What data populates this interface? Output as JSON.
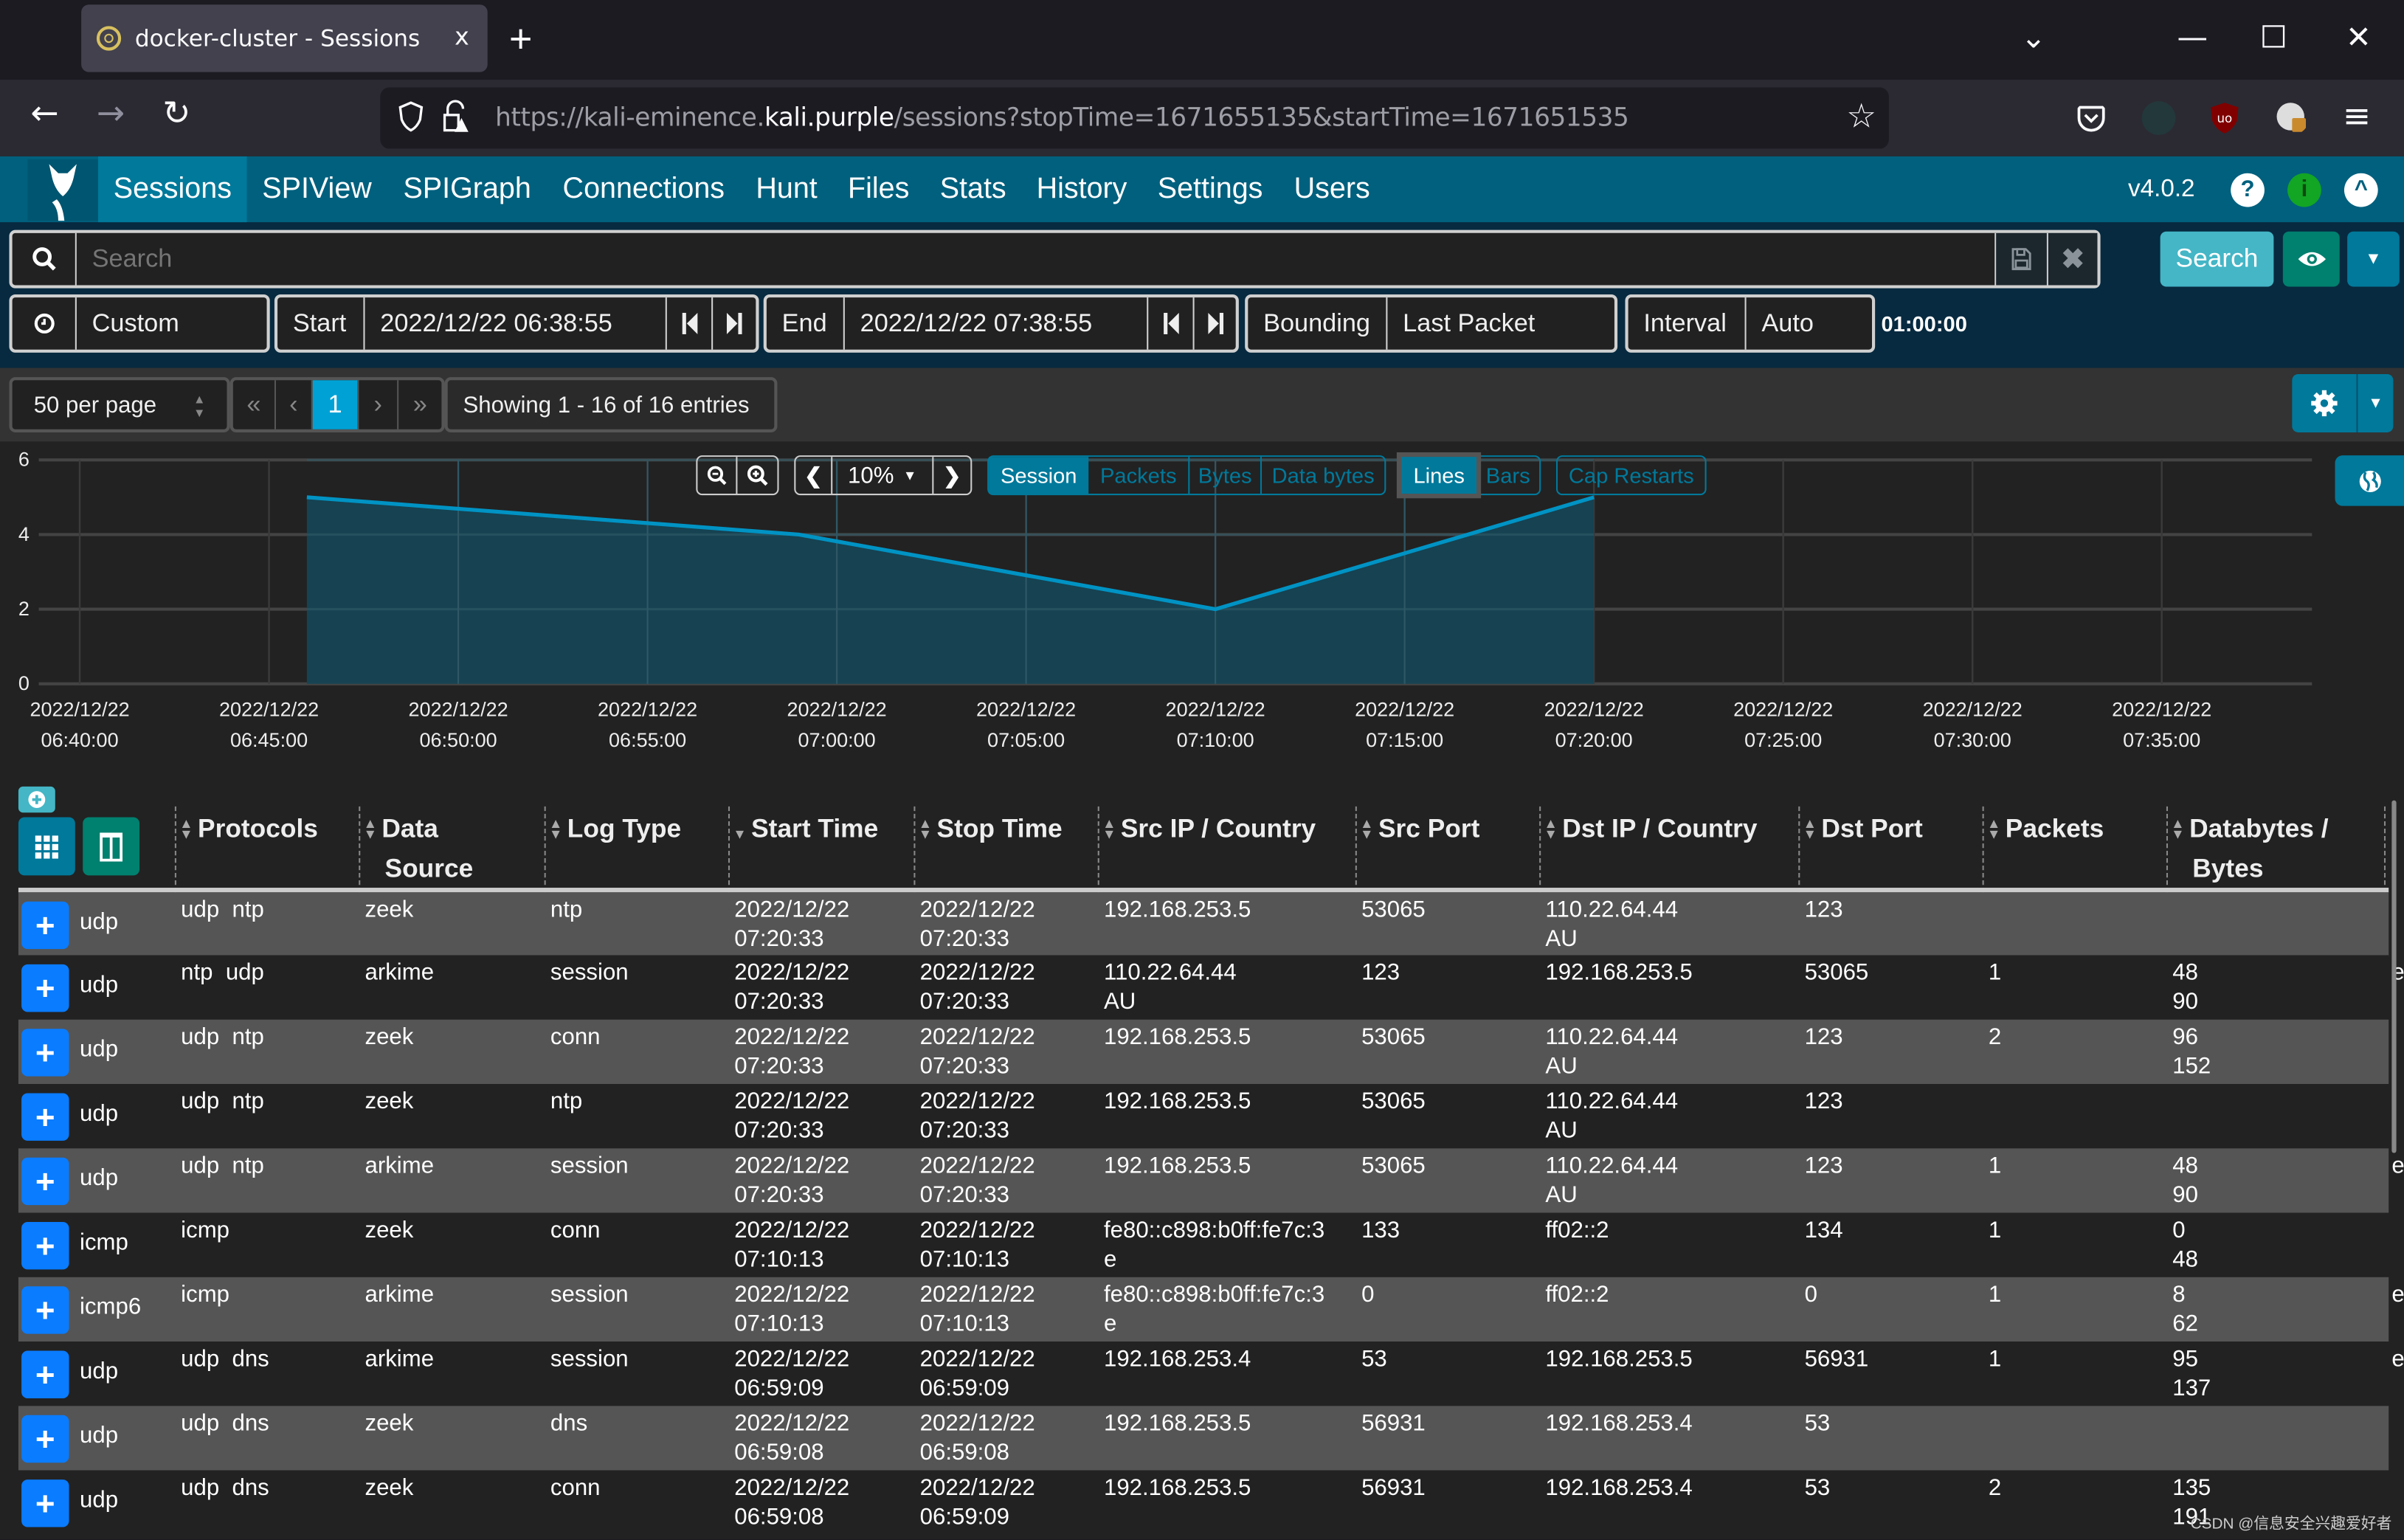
{
  "browser": {
    "tab_title": "docker-cluster - Sessions",
    "tab_close": "x",
    "new_tab": "+",
    "url_prefix": "https://kali-eminence.",
    "url_host": "kali.purple",
    "url_path": "/sessions?stopTime=1671655135&startTime=1671651535",
    "window_controls": {
      "list": "⌄",
      "minimize": "—",
      "maximize": "☐",
      "close": "✕"
    },
    "nav": {
      "back": "←",
      "forward": "→",
      "reload": "↻"
    }
  },
  "appnav": {
    "items": [
      {
        "label": "Sessions",
        "active": true
      },
      {
        "label": "SPIView"
      },
      {
        "label": "SPIGraph"
      },
      {
        "label": "Connections"
      },
      {
        "label": "Hunt"
      },
      {
        "label": "Files"
      },
      {
        "label": "Stats"
      },
      {
        "label": "History"
      },
      {
        "label": "Settings"
      },
      {
        "label": "Users"
      }
    ],
    "version": "v4.0.2",
    "help_icon": "?",
    "info_icon": "i",
    "collapse_icon": "^"
  },
  "search": {
    "placeholder": "Search",
    "value": "",
    "button_label": "Search"
  },
  "timerange": {
    "preset": "Custom",
    "start_label": "Start",
    "start_value": "2022/12/22 06:38:55",
    "end_label": "End",
    "end_value": "2022/12/22 07:38:55",
    "bounding_label": "Bounding",
    "bounding_value": "Last Packet",
    "interval_label": "Interval",
    "interval_value": "Auto",
    "duration": "01:00:00"
  },
  "pager": {
    "per_page": "50 per page",
    "first": "«",
    "prev": "‹",
    "current_page": "1",
    "next": "›",
    "last": "»",
    "showing": "Showing 1 - 16 of 16 entries"
  },
  "chart_controls": {
    "zoom_level": "10%",
    "metrics": [
      "Session",
      "Packets",
      "Bytes",
      "Data bytes"
    ],
    "active_metric": "Session",
    "styles": [
      "Lines",
      "Bars"
    ],
    "active_style": "Lines",
    "cap_restarts": "Cap Restarts"
  },
  "chart_data": {
    "type": "area",
    "title": "",
    "xlabel": "",
    "ylabel": "",
    "ylim": [
      0,
      6
    ],
    "yticks": [
      "0",
      "2",
      "4",
      "6"
    ],
    "xlim_minutes": [
      -1.0,
      58.5
    ],
    "x_tick_minutes": [
      0,
      5,
      10,
      15,
      20,
      25,
      30,
      35,
      40,
      45,
      50,
      55
    ],
    "x_ticks": [
      {
        "date": "2022/12/22",
        "time": "06:40:00"
      },
      {
        "date": "2022/12/22",
        "time": "06:45:00"
      },
      {
        "date": "2022/12/22",
        "time": "06:50:00"
      },
      {
        "date": "2022/12/22",
        "time": "06:55:00"
      },
      {
        "date": "2022/12/22",
        "time": "07:00:00"
      },
      {
        "date": "2022/12/22",
        "time": "07:05:00"
      },
      {
        "date": "2022/12/22",
        "time": "07:10:00"
      },
      {
        "date": "2022/12/22",
        "time": "07:15:00"
      },
      {
        "date": "2022/12/22",
        "time": "07:20:00"
      },
      {
        "date": "2022/12/22",
        "time": "07:25:00"
      },
      {
        "date": "2022/12/22",
        "time": "07:30:00"
      },
      {
        "date": "2022/12/22",
        "time": "07:35:00"
      }
    ],
    "series": [
      {
        "name": "Session",
        "points": [
          {
            "x_minutes": 6.0,
            "label": "06:46",
            "y": 5
          },
          {
            "x_minutes": 19.0,
            "label": "06:59",
            "y": 4
          },
          {
            "x_minutes": 30.0,
            "label": "07:10",
            "y": 2
          },
          {
            "x_minutes": 40.0,
            "label": "07:20",
            "y": 5
          }
        ]
      }
    ],
    "grid": true,
    "legend": "none"
  },
  "table": {
    "columns": [
      "Protocols",
      "Data Source",
      "Log Type",
      "Start Time",
      "Stop Time",
      "Src IP / Country",
      "Src Port",
      "Dst IP / Country",
      "Dst Port",
      "Packets",
      "Databytes / Bytes"
    ],
    "header_lines": [
      [
        "Protocols"
      ],
      [
        "Data",
        "Source"
      ],
      [
        "Log Type"
      ],
      [
        "Start Time"
      ],
      [
        "Stop Time"
      ],
      [
        "Src IP / Country"
      ],
      [
        "Src Port"
      ],
      [
        "Dst IP / Country"
      ],
      [
        "Dst Port"
      ],
      [
        "Packets"
      ],
      [
        "Databytes /",
        "Bytes"
      ]
    ],
    "sorted_column": "Start Time",
    "rows": [
      {
        "proto": "udp",
        "protocols": "udp  ntp",
        "source": "zeek",
        "logtype": "ntp",
        "start": [
          "2022/12/22",
          "07:20:33"
        ],
        "stop": [
          "2022/12/22",
          "07:20:33"
        ],
        "src": [
          "192.168.253.5",
          ""
        ],
        "sport": "53065",
        "dst": [
          "110.22.64.44",
          "AU"
        ],
        "dport": "123",
        "packets": "",
        "bytes": [
          "",
          ""
        ],
        "extra": ""
      },
      {
        "proto": "udp",
        "protocols": "ntp  udp",
        "source": "arkime",
        "logtype": "session",
        "start": [
          "2022/12/22",
          "07:20:33"
        ],
        "stop": [
          "2022/12/22",
          "07:20:33"
        ],
        "src": [
          "110.22.64.44",
          "AU"
        ],
        "sport": "123",
        "dst": [
          "192.168.253.5",
          ""
        ],
        "dport": "53065",
        "packets": "1",
        "bytes": [
          "48",
          "90"
        ],
        "extra": "e"
      },
      {
        "proto": "udp",
        "protocols": "udp  ntp",
        "source": "zeek",
        "logtype": "conn",
        "start": [
          "2022/12/22",
          "07:20:33"
        ],
        "stop": [
          "2022/12/22",
          "07:20:33"
        ],
        "src": [
          "192.168.253.5",
          ""
        ],
        "sport": "53065",
        "dst": [
          "110.22.64.44",
          "AU"
        ],
        "dport": "123",
        "packets": "2",
        "bytes": [
          "96",
          "152"
        ],
        "extra": ""
      },
      {
        "proto": "udp",
        "protocols": "udp  ntp",
        "source": "zeek",
        "logtype": "ntp",
        "start": [
          "2022/12/22",
          "07:20:33"
        ],
        "stop": [
          "2022/12/22",
          "07:20:33"
        ],
        "src": [
          "192.168.253.5",
          ""
        ],
        "sport": "53065",
        "dst": [
          "110.22.64.44",
          "AU"
        ],
        "dport": "123",
        "packets": "",
        "bytes": [
          "",
          ""
        ],
        "extra": ""
      },
      {
        "proto": "udp",
        "protocols": "udp  ntp",
        "source": "arkime",
        "logtype": "session",
        "start": [
          "2022/12/22",
          "07:20:33"
        ],
        "stop": [
          "2022/12/22",
          "07:20:33"
        ],
        "src": [
          "192.168.253.5",
          ""
        ],
        "sport": "53065",
        "dst": [
          "110.22.64.44",
          "AU"
        ],
        "dport": "123",
        "packets": "1",
        "bytes": [
          "48",
          "90"
        ],
        "extra": "e"
      },
      {
        "proto": "icmp",
        "protocols": "icmp",
        "source": "zeek",
        "logtype": "conn",
        "start": [
          "2022/12/22",
          "07:10:13"
        ],
        "stop": [
          "2022/12/22",
          "07:10:13"
        ],
        "src": [
          "fe80::c898:b0ff:fe7c:3",
          "e"
        ],
        "sport": "133",
        "dst": [
          "ff02::2",
          ""
        ],
        "dport": "134",
        "packets": "1",
        "bytes": [
          "0",
          "48"
        ],
        "extra": ""
      },
      {
        "proto": "icmp6",
        "protocols": "icmp",
        "source": "arkime",
        "logtype": "session",
        "start": [
          "2022/12/22",
          "07:10:13"
        ],
        "stop": [
          "2022/12/22",
          "07:10:13"
        ],
        "src": [
          "fe80::c898:b0ff:fe7c:3",
          "e"
        ],
        "sport": "0",
        "dst": [
          "ff02::2",
          ""
        ],
        "dport": "0",
        "packets": "1",
        "bytes": [
          "8",
          "62"
        ],
        "extra": "e"
      },
      {
        "proto": "udp",
        "protocols": "udp  dns",
        "source": "arkime",
        "logtype": "session",
        "start": [
          "2022/12/22",
          "06:59:09"
        ],
        "stop": [
          "2022/12/22",
          "06:59:09"
        ],
        "src": [
          "192.168.253.4",
          ""
        ],
        "sport": "53",
        "dst": [
          "192.168.253.5",
          ""
        ],
        "dport": "56931",
        "packets": "1",
        "bytes": [
          "95",
          "137"
        ],
        "extra": "e"
      },
      {
        "proto": "udp",
        "protocols": "udp  dns",
        "source": "zeek",
        "logtype": "dns",
        "start": [
          "2022/12/22",
          "06:59:08"
        ],
        "stop": [
          "2022/12/22",
          "06:59:08"
        ],
        "src": [
          "192.168.253.5",
          ""
        ],
        "sport": "56931",
        "dst": [
          "192.168.253.4",
          ""
        ],
        "dport": "53",
        "packets": "",
        "bytes": [
          "",
          ""
        ],
        "extra": ""
      },
      {
        "proto": "udp",
        "protocols": "udp  dns",
        "source": "zeek",
        "logtype": "conn",
        "start": [
          "2022/12/22",
          "06:59:08"
        ],
        "stop": [
          "2022/12/22",
          "06:59:09"
        ],
        "src": [
          "192.168.253.5",
          ""
        ],
        "sport": "56931",
        "dst": [
          "192.168.253.4",
          ""
        ],
        "dport": "53",
        "packets": "2",
        "bytes": [
          "135",
          "191"
        ],
        "extra": ""
      }
    ]
  },
  "watermark": "CSDN @信息安全兴趣爱好者",
  "colors": {
    "nav_bg": "#00607e",
    "nav_active": "#00799b",
    "search_btn": "#44b6c6",
    "eye_btn": "#00806e",
    "primary": "#00799b",
    "row_plus": "#0a7cff",
    "chart_line": "#0093c4",
    "chart_fill": "#164454"
  }
}
